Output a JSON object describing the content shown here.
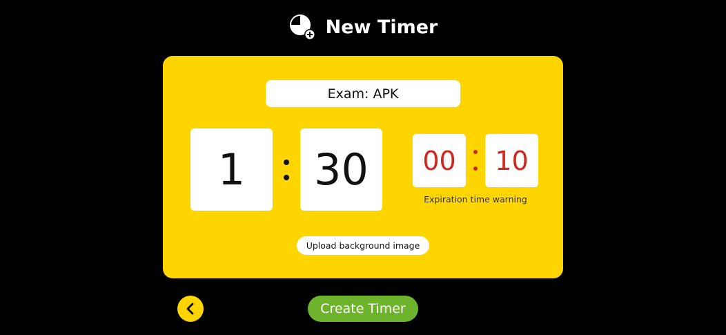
{
  "header": {
    "title": "New Timer",
    "icon": "timer-add-icon"
  },
  "form": {
    "timer_name": "Exam: APK",
    "duration": {
      "hours": "1",
      "minutes": "30"
    },
    "warning": {
      "minutes": "00",
      "seconds": "10",
      "label": "Expiration time warning"
    },
    "upload_label": "Upload background image"
  },
  "footer": {
    "back_icon": "chevron-left-icon",
    "create_label": "Create Timer"
  },
  "colors": {
    "background": "#000000",
    "card": "#FFD500",
    "warning_text": "#D0281E",
    "create_button": "#6DB32B"
  }
}
